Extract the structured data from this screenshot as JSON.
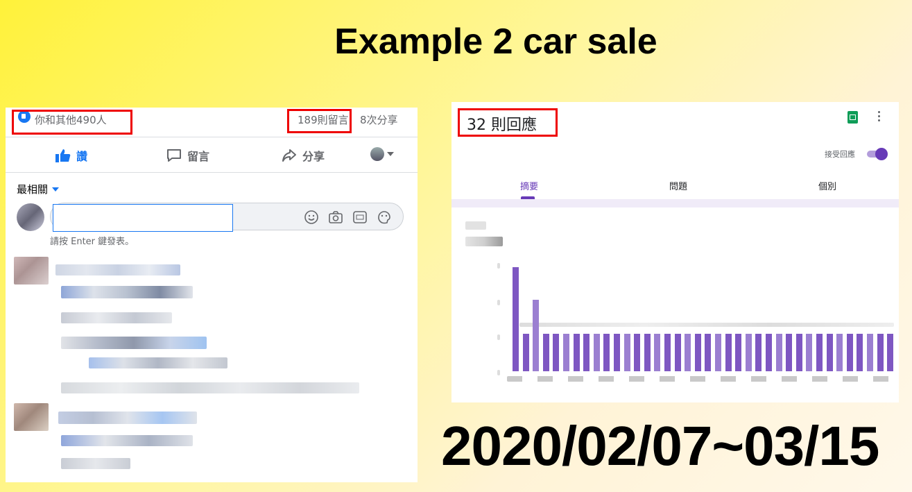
{
  "slide": {
    "title": "Example 2 car sale",
    "date_range": "2020/02/07~03/15"
  },
  "facebook_post": {
    "reactions_text": "你和其他490人",
    "comments_count": "189則留言",
    "shares_count": "8次分享",
    "actions": {
      "like": "讚",
      "comment": "留言",
      "share": "分享"
    },
    "sort_label": "最相關",
    "comment_hint": "請按 Enter 鍵發表。",
    "icons": [
      "like-reaction-icon",
      "thumbs-up-icon",
      "comment-bubble-icon",
      "share-arrow-icon",
      "emoji-icon",
      "camera-icon",
      "gif-icon",
      "sticker-icon"
    ],
    "colors": {
      "accent": "#1877f2",
      "highlight_box": "#e00000"
    }
  },
  "google_form": {
    "responses_title": "32 則回應",
    "accept_responses_label": "接受回應",
    "accepting_responses": true,
    "tabs": [
      {
        "label": "摘要",
        "active": true
      },
      {
        "label": "問題",
        "active": false
      },
      {
        "label": "個別",
        "active": false
      }
    ],
    "icons": [
      "sheets-icon",
      "more-vert-icon"
    ],
    "colors": {
      "accent": "#673ab7",
      "bar": "#7e57c2"
    },
    "chart_relative_heights": [
      1.0,
      0.36,
      0.69,
      0.36,
      0.36,
      0.36,
      0.36,
      0.36,
      0.36,
      0.36,
      0.36,
      0.36,
      0.36,
      0.36,
      0.36,
      0.36,
      0.36,
      0.36,
      0.36,
      0.36,
      0.36,
      0.36,
      0.36,
      0.36,
      0.36,
      0.36,
      0.36,
      0.36,
      0.36,
      0.36,
      0.36,
      0.36,
      0.36,
      0.36,
      0.36,
      0.36,
      0.36,
      0.36
    ]
  }
}
